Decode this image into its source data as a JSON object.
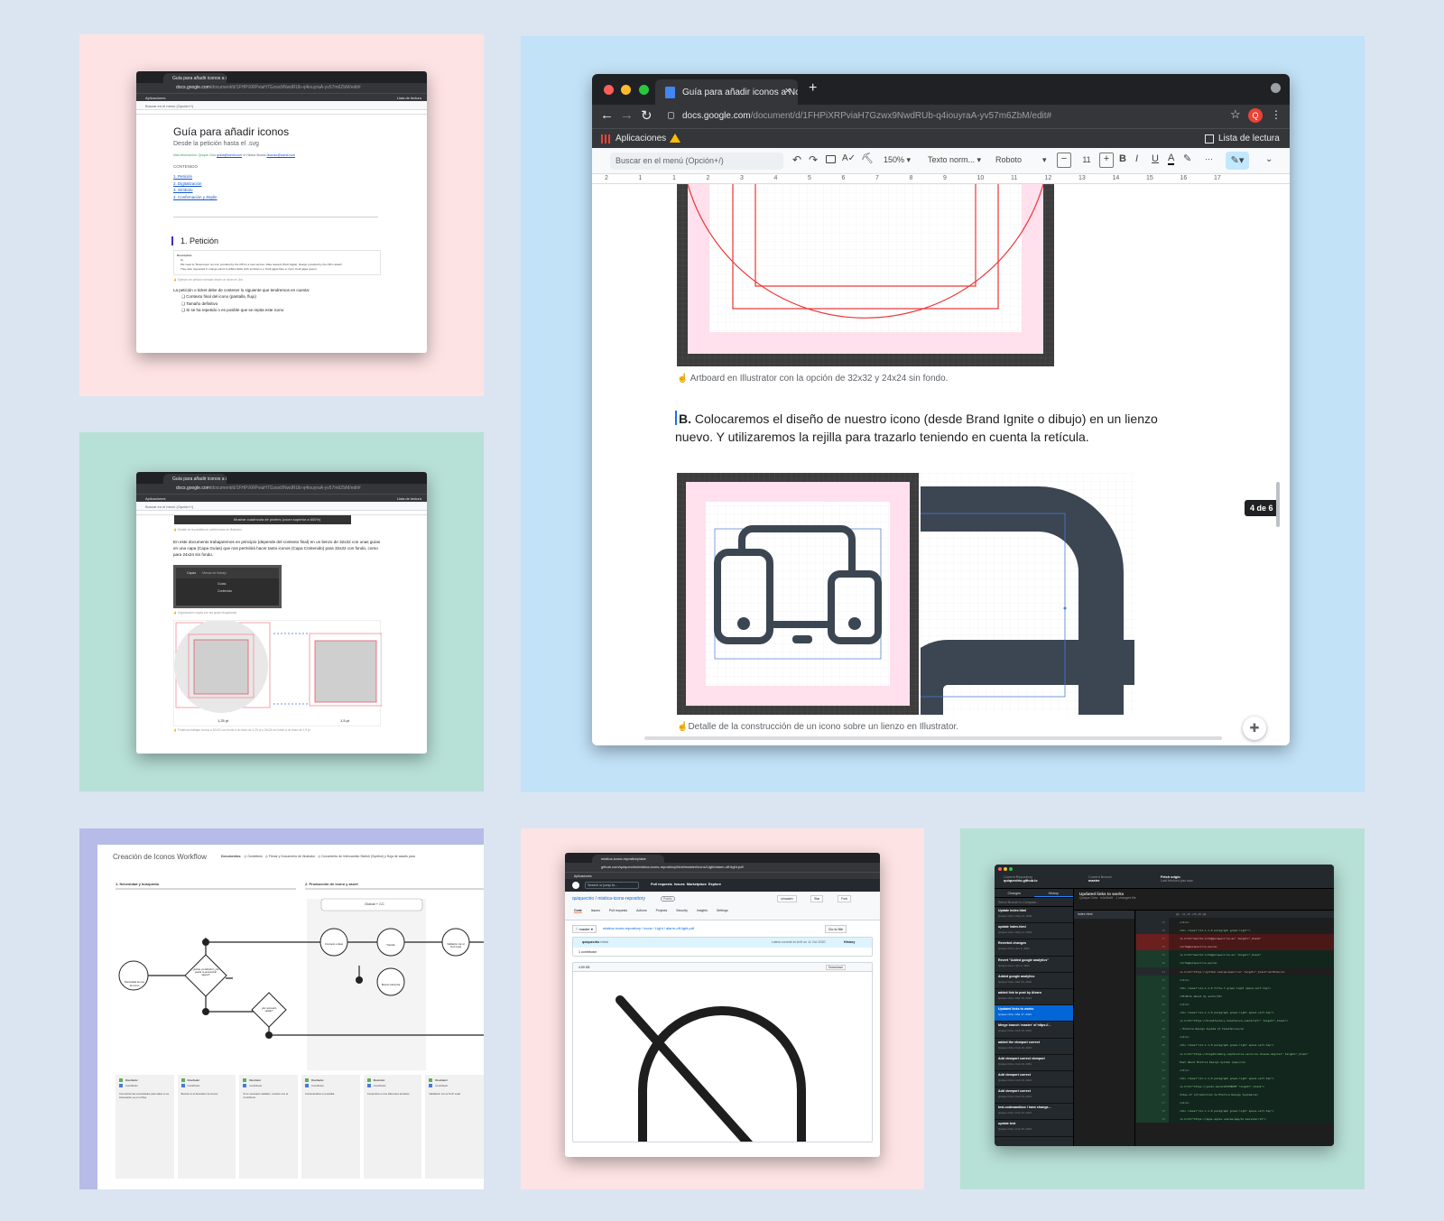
{
  "colors": {
    "bg": "#dbe5f1",
    "pink": "#fde3e4",
    "mint": "#b7e0d6",
    "blue": "#c2e2f8",
    "lavender": "#b6bbe8",
    "mint2": "#b7e0d6",
    "pink2": "#fde3e4",
    "accent": "#ea4335",
    "dark": "#202124"
  },
  "docs": {
    "tab_title": "Guía para añadir iconos a Nov",
    "url_host": "docs.google.com",
    "url_path": "/document/d/1FHPiXRPviaH7Gzwx9NwdRUb-q4iouyraA-yv57m6ZbM/edit#",
    "apps_label": "Aplicaciones",
    "reading_list": "Lista de lectura",
    "menu_search": "Buscar en el menú (Opción+/)",
    "zoom": "150%",
    "style": "Texto norm...",
    "font": "Roboto",
    "font_size": "11",
    "avatar": "Q",
    "artboard_caption": "Artboard  en Illustrator con la opción de 32x32 y 24x24 sin fondo.",
    "section_b_letter": "B.",
    "section_b_text": " Colocaremos el diseño de nuestro icono (desde Brand Ignite o dibujo) en un lienzo nuevo. Y utilizaremos la rejilla para trazarlo teniendo en cuenta la retícula.",
    "detail_caption": "Detalle de la construcción de un icono sobre un lienzo en Illustrator.",
    "page_badge": "4 de 6",
    "ruler_ticks": [
      "2",
      "1",
      "1",
      "2",
      "3",
      "4",
      "5",
      "6",
      "7",
      "8",
      "9",
      "10",
      "11",
      "12",
      "13",
      "14",
      "15",
      "16",
      "17"
    ],
    "bold": "B",
    "italic": "I",
    "underline": "U",
    "text_color": "A",
    "more": "···"
  },
  "small_doc1": {
    "title": "Guía para añadir iconos",
    "subtitle": "Desde la petición hasta el .svg",
    "more_info": "Más información: Quique Ciria ",
    "email1": "qciria@tuenti.com",
    "or": " or Hector Borolo ",
    "email2": "hborolo@tuenti.com",
    "contents": "CONTENIDO",
    "toc": [
      "1. Petición",
      "2. Digitalización",
      "3. Símbolo",
      "4. Confirmación y Zeplin"
    ],
    "heading": "1. Petición",
    "desc_label": "Description",
    "desc_lines": [
      "Hi,",
      "We need to \"Resources\" an icon provided by the CB for a new service: Data request (Pedi Gigas). Design provided by the CB in attach.",
      "They also requested in orange colors to differentiate both services (i.e: Pedi gigas blue or cyan, Pedi gigas green)"
    ],
    "example": "Ejemplo de petición tomada desde un ticket en Jira",
    "intro": "La petición o ticket debe de contener lo siguiente que tendremos en cuenta:",
    "list": [
      "Contexto final del icono (pantalla, flujo)",
      "Tamaño definitivo",
      "Si se ha repetido o es posible que se repita este icono"
    ]
  },
  "small_doc2": {
    "banner": "Mostrar cuadrícula de píxeles (zoom superior a 600%)",
    "note1": "Detalle de la pantalla de preferencias de Illustrator",
    "para": "En este documento trabajaremos en principio (depende del contexto final) en un lienzo de 32x32 con unas guías en una capa (Capa Guías) que nos permitirá hacer tanto iconos (Capa Contenido) para 32x32 con fondo, como para 24x24 sin fondo.",
    "layers_tabs": [
      "Capas",
      "Mesas de trabajo"
    ],
    "layers": [
      "Guías",
      "Contenido"
    ],
    "note2": "Organización capas con las guías bloqueadas",
    "dim1": "1,25 pt",
    "dim2": "1,5 pt",
    "note3": "Podemos trabajar iconos a 32x32 con fondo a un trazo de 1,25 pt y 24x24 sin fondo a un trazo de 1,5 pt."
  },
  "workflow": {
    "title": "Creación de Iconos Workflow",
    "tabs": [
      "Documentos:",
      "Guidelines",
      "Flexar y Documento de Illustrator",
      "Documento de Intercambio Sketch (Symbol) y Hoja de assets para"
    ],
    "lane1": "1. Necesidad y búsqueda",
    "lane2": "2. Producción de icono y asset",
    "global": "Global + CC",
    "nodes": [
      "Necesidad de uso de icono",
      "¿Existe ya definido? ¿Se puede re-aprovechar alguno?",
      "Concepto e ideas",
      "Trazado",
      "Validación con el Tech Lead",
      "¿Es necesario validar?",
      "Buscar referencia"
    ],
    "cards": [
      {
        "name": "Diseñador",
        "role": "Contributor",
        "text": "Comunicar las necesidades para saber si es interesante ya en el flujo"
      },
      {
        "name": "Diseñador",
        "role": "Contributor",
        "text": "Buscar en el buscador de iconos"
      },
      {
        "name": "Illustrator",
        "role": "Contributor",
        "text": "Si es necesario validarlo, revisión con el Contributor"
      },
      {
        "name": "Diseñador",
        "role": "Contributor",
        "text": "Contextualizar en pantalla"
      },
      {
        "name": "Illustrator",
        "role": "Contributor",
        "text": "Comprobar en los diferentes tamaños"
      },
      {
        "name": "Diseñador",
        "role": "Contributor",
        "text": "Validación con el Tech Lead"
      }
    ]
  },
  "github": {
    "tab": "mistica-icons-repository/alar",
    "url": "github.com/quiquecirio/mistica-icons-repository/blob/master/icons/Light/alarm-off-light.pdf",
    "apps": "Aplicaciones",
    "search": "Search or jump to...",
    "nav": [
      "Pull requests",
      "Issues",
      "Marketplace",
      "Explore"
    ],
    "repo": "quiquecirio / mistica-icons-repository",
    "public": "Public",
    "repo_tabs": [
      "Code",
      "Issues",
      "Pull requests",
      "Actions",
      "Projects",
      "Security",
      "Insights",
      "Settings"
    ],
    "branch": "master",
    "path": "mistica-icons-repository / icons / Light / alarm-off-light.pdf",
    "go_to_file": "Go to file",
    "commit_user": "quiquecirio",
    "commit_msg": "Initial",
    "latest_commit": "Latest commit 4c1e3f on 11 Oct 2020",
    "history": "History",
    "contributor": "1 contributor",
    "size": "4.59 KB",
    "download": "Download",
    "watch": "Unwatch",
    "star": "Star",
    "fork": "Fork"
  },
  "desktop": {
    "repo_label": "Current Repository",
    "repo": "quiquecirio.github.io",
    "branch_label": "Current Branch",
    "branch": "master",
    "fetch": "Fetch origin",
    "fetched": "Last fetched just now",
    "tabs": [
      "Changes",
      "History"
    ],
    "filter": "Select Branch to Compare...",
    "commit_title": "Updated links to works",
    "author": "Quique Ciria",
    "sha": "b1d4bd5",
    "changed": "1 changed file",
    "file": "index.html",
    "hunk": "@@ -31,10 +35,40 @@",
    "commits": [
      {
        "t": "Update index.html",
        "d": "Quique Ciria • May 14, 2021"
      },
      {
        "t": "update index.html",
        "d": "Quique Ciria • May 11, 2021"
      },
      {
        "t": "Reverted changes",
        "d": "Quique Ciria • Apr 2, 2021"
      },
      {
        "t": "Revert \"Added google analytics\"",
        "d": "Quique Ciria • Apr 2, 2021"
      },
      {
        "t": "Added google analytics",
        "d": "Quique Ciria • Mar 23, 2021"
      },
      {
        "t": "added link to post by Alvaro",
        "d": "Quique Ciria • Mar 19, 2021"
      },
      {
        "t": "Updated links to works",
        "d": "Quique Ciria • Mar 17, 2021"
      },
      {
        "t": "Merge branch 'master' of https://...",
        "d": "Quique Ciria • Feb 19, 2021"
      },
      {
        "t": "added the viewport correct",
        "d": "Quique Ciria • Feb 19, 2021"
      },
      {
        "t": "Add viewport correct viewport",
        "d": "Quique Ciria • Feb 19, 2021"
      },
      {
        "t": "Add viewport correct",
        "d": "Quique Ciria • Feb 19, 2021"
      },
      {
        "t": "Add viewport correct",
        "d": "Quique Ciria • Feb 19, 2021"
      },
      {
        "t": "test-codesandbox I have change...",
        "d": "Quique Ciria • Feb 19, 2021"
      },
      {
        "t": "update test",
        "d": "Quique Ciria • Feb 19, 2021"
      }
    ],
    "code": [
      {
        "n": "35",
        "m": "n",
        "c": "</div>"
      },
      {
        "n": "36",
        "m": "n",
        "c": "<div class=\"col-1-1-0 paragraph green-light\">"
      },
      {
        "n": "37",
        "m": "d",
        "c": "<a href=\"mailto:info@quiquecirio.es\" target=\"_blank\""
      },
      {
        "n": "38",
        "m": "d",
        "c": ">info@quiquecirio.es</a>"
      },
      {
        "n": "39",
        "m": "a",
        "c": "<a href=\"mailto:info@quiquecirio.es\" target=\"_blank\""
      },
      {
        "n": "40",
        "m": "a",
        "c": ">info@quiquecirio.es</a>"
      },
      {
        "n": "41",
        "m": "n",
        "c": "<a href=\"https://github.com/quiquecirio\" target=\"_blank\">GitHub</a>"
      },
      {
        "n": "42",
        "m": "a",
        "c": "</div>"
      },
      {
        "n": "43",
        "m": "a",
        "c": "<div class=\"col-1-1-0 title-3 green-light space-vert-top\">"
      },
      {
        "n": "44",
        "m": "a",
        "c": "<h3>Bits about my work</h3>"
      },
      {
        "n": "45",
        "m": "a",
        "c": "</div>"
      },
      {
        "n": "46",
        "m": "a",
        "c": "<div class=\"col-1-1-0 paragraph green-light space-vert-top\">"
      },
      {
        "n": "47",
        "m": "a",
        "c": "<a href=\"https://brandfactory.telefonica.com/d/iqYr\" target=\"_blank\">"
      },
      {
        "n": "48",
        "m": "a",
        "c": "• Mística Design System of Telefónica</a>"
      },
      {
        "n": "49",
        "m": "a",
        "c": "</div>"
      },
      {
        "n": "50",
        "m": "a",
        "c": "<div class=\"col-1-1-0 paragraph green-light space-vert-top\">"
      },
      {
        "n": "51",
        "m": "a",
        "c": "<a href=\"https://blogthinkbig.com/mistica-servicio-diseno-digital\" target=\"_blank\""
      },
      {
        "n": "52",
        "m": "a",
        "c": "Post about Mística Design System (spa)</a>"
      },
      {
        "n": "53",
        "m": "a",
        "c": "</div>"
      },
      {
        "n": "54",
        "m": "a",
        "c": "<div class=\"col-1-1-0 paragraph green-light space-vert-top\">"
      },
      {
        "n": "55",
        "m": "a",
        "c": "<a href=\"https://youtu.be/eCLE3XH69M\" target=\"_blank\">"
      },
      {
        "n": "56",
        "m": "a",
        "c": "Video of introduction to Mística Design System</a>"
      },
      {
        "n": "57",
        "m": "a",
        "c": "</div>"
      },
      {
        "n": "58",
        "m": "a",
        "c": "<div class=\"col-1-1-0 paragraph green-light space-vert-top\">"
      },
      {
        "n": "59",
        "m": "a",
        "c": "<a href=\"https://apps.apple.com/es/app/mi-movistar/id\">"
      }
    ]
  }
}
